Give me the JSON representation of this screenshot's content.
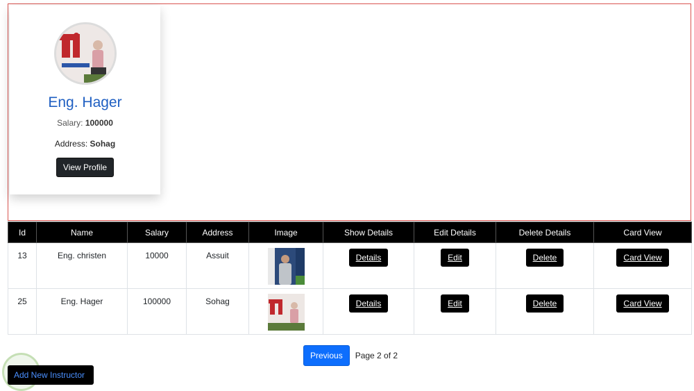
{
  "card": {
    "name": "Eng. Hager",
    "salary_label": "Salary:",
    "salary_value": "100000",
    "address_label": "Address:",
    "address_value": "Sohag",
    "button_label": "View Profile"
  },
  "table": {
    "headers": [
      "Id",
      "Name",
      "Salary",
      "Address",
      "Image",
      "Show Details",
      "Edit Details",
      "Delete Details",
      "Card View"
    ],
    "rows": [
      {
        "id": "13",
        "name": "Eng. christen",
        "salary": "10000",
        "address": "Assuit",
        "details": "Details",
        "edit": "Edit",
        "delete": "Delete",
        "card": "Card View"
      },
      {
        "id": "25",
        "name": "Eng. Hager",
        "salary": "100000",
        "address": "Sohag",
        "details": "Details",
        "edit": "Edit",
        "delete": "Delete",
        "card": "Card View"
      }
    ]
  },
  "pager": {
    "previous_label": "Previous",
    "page_info": "Page 2 of 2"
  },
  "add_button_label": "Add New Instructor",
  "colors": {
    "accent": "#0d6efd",
    "name": "#1f5fc2",
    "border": "#d9534f"
  }
}
